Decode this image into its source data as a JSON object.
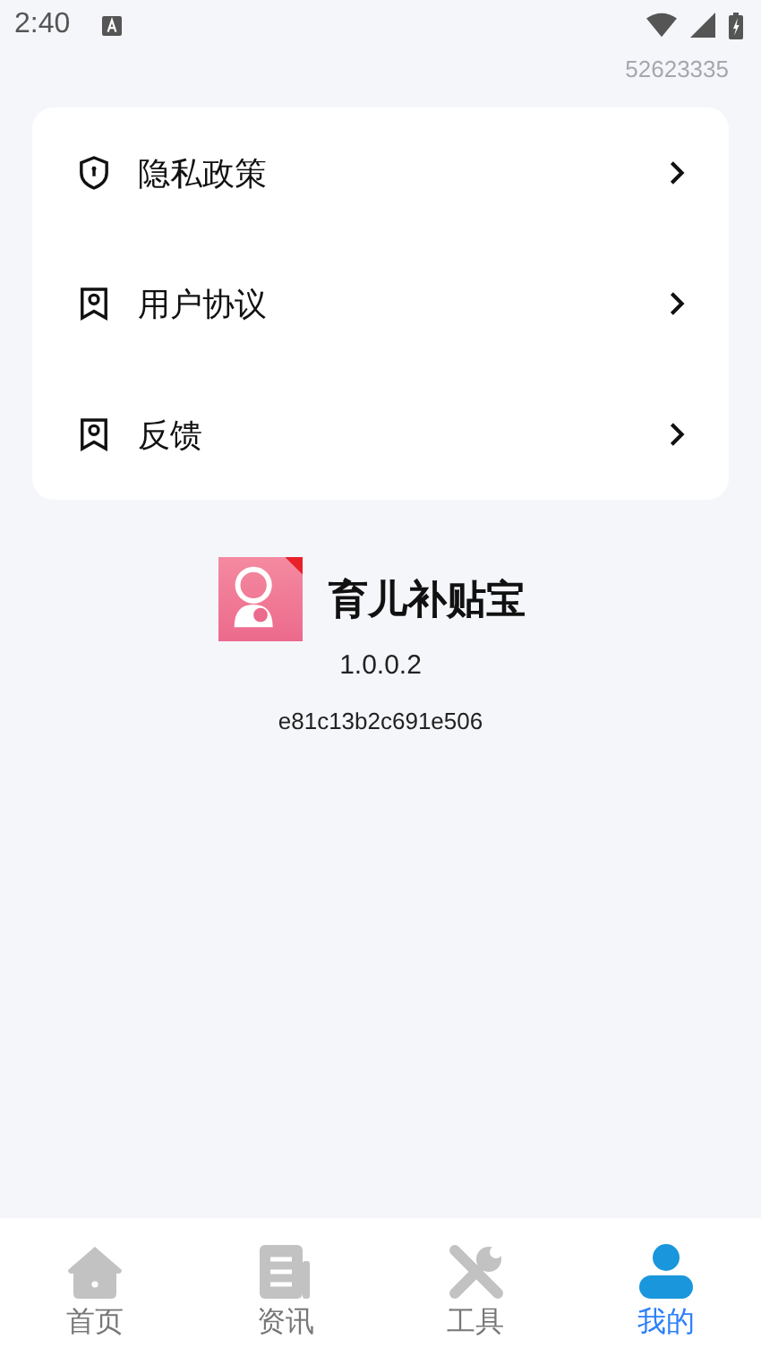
{
  "status_bar": {
    "time": "2:40"
  },
  "user_id": "52623335",
  "menu": [
    {
      "kind": "shield",
      "label": "隐私政策"
    },
    {
      "kind": "bookmark",
      "label": "用户协议"
    },
    {
      "kind": "bookmark",
      "label": "反馈"
    }
  ],
  "app": {
    "name": "育儿补贴宝",
    "version": "1.0.0.2",
    "build": "e81c13b2c691e506"
  },
  "tabs": [
    {
      "kind": "home",
      "label": "首页",
      "selected": false
    },
    {
      "kind": "news",
      "label": "资讯",
      "selected": false
    },
    {
      "kind": "tools",
      "label": "工具",
      "selected": false
    },
    {
      "kind": "person",
      "label": "我的",
      "selected": true
    }
  ]
}
